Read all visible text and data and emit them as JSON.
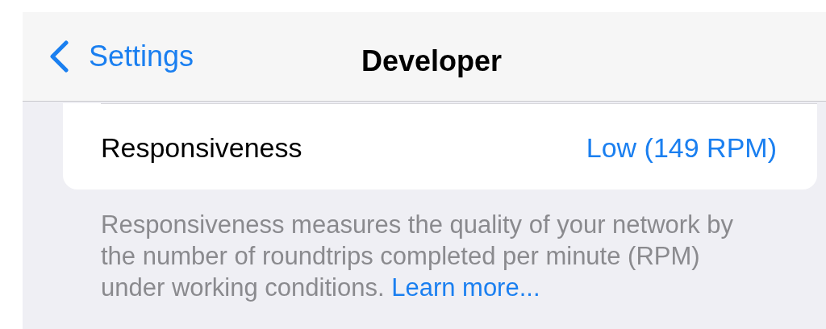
{
  "nav": {
    "back_label": "Settings",
    "title": "Developer"
  },
  "rows": [
    {
      "label": "Responsiveness",
      "value": "Low (149 RPM)"
    }
  ],
  "footer": {
    "text": "Responsiveness measures the quality of your network by the number of roundtrips completed per minute (RPM) under working conditions.",
    "link": "Learn more..."
  }
}
